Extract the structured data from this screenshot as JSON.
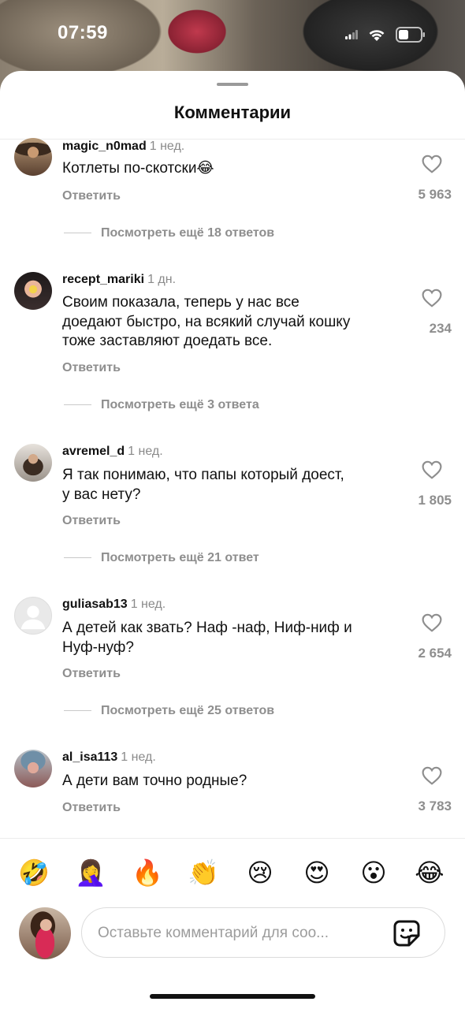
{
  "status_bar": {
    "time": "07:59"
  },
  "sheet": {
    "title": "Комментарии"
  },
  "comments": [
    {
      "username": "magic_n0mad",
      "time": "1 нед.",
      "lines": [
        "Котлеты по-скотски😂"
      ],
      "reply": "Ответить",
      "likes": "5 963",
      "more": "Посмотреть ещё 18 ответов"
    },
    {
      "username": "recept_mariki",
      "time": "1 дн.",
      "lines": [
        "Своим показала, теперь у нас все",
        "доедают быстро, на всякий случай кошку",
        "тоже заставляют доедать все."
      ],
      "reply": "Ответить",
      "likes": "234",
      "more": "Посмотреть ещё 3 ответа"
    },
    {
      "username": "avremel_d",
      "time": "1 нед.",
      "lines": [
        "Я так понимаю, что папы который доест,",
        "у вас нету?"
      ],
      "reply": "Ответить",
      "likes": "1 805",
      "more": "Посмотреть ещё 21 ответ"
    },
    {
      "username": "guliasab13",
      "time": "1 нед.",
      "lines": [
        "А детей как звать? Наф -наф, Ниф-ниф и",
        "Нуф-нуф?"
      ],
      "reply": "Ответить",
      "likes": "2 654",
      "more": "Посмотреть ещё 25 ответов"
    },
    {
      "username": "al_isa113",
      "time": "1 нед.",
      "lines": [
        "А дети вам точно родные?"
      ],
      "reply": "Ответить",
      "likes": "3 783"
    }
  ],
  "quick_reactions": [
    "🤣",
    "🤦‍♀️",
    "🔥",
    "👏",
    "😢",
    "😍",
    "😮",
    "😂"
  ],
  "composer": {
    "placeholder": "Оставьте комментарий для соо..."
  }
}
